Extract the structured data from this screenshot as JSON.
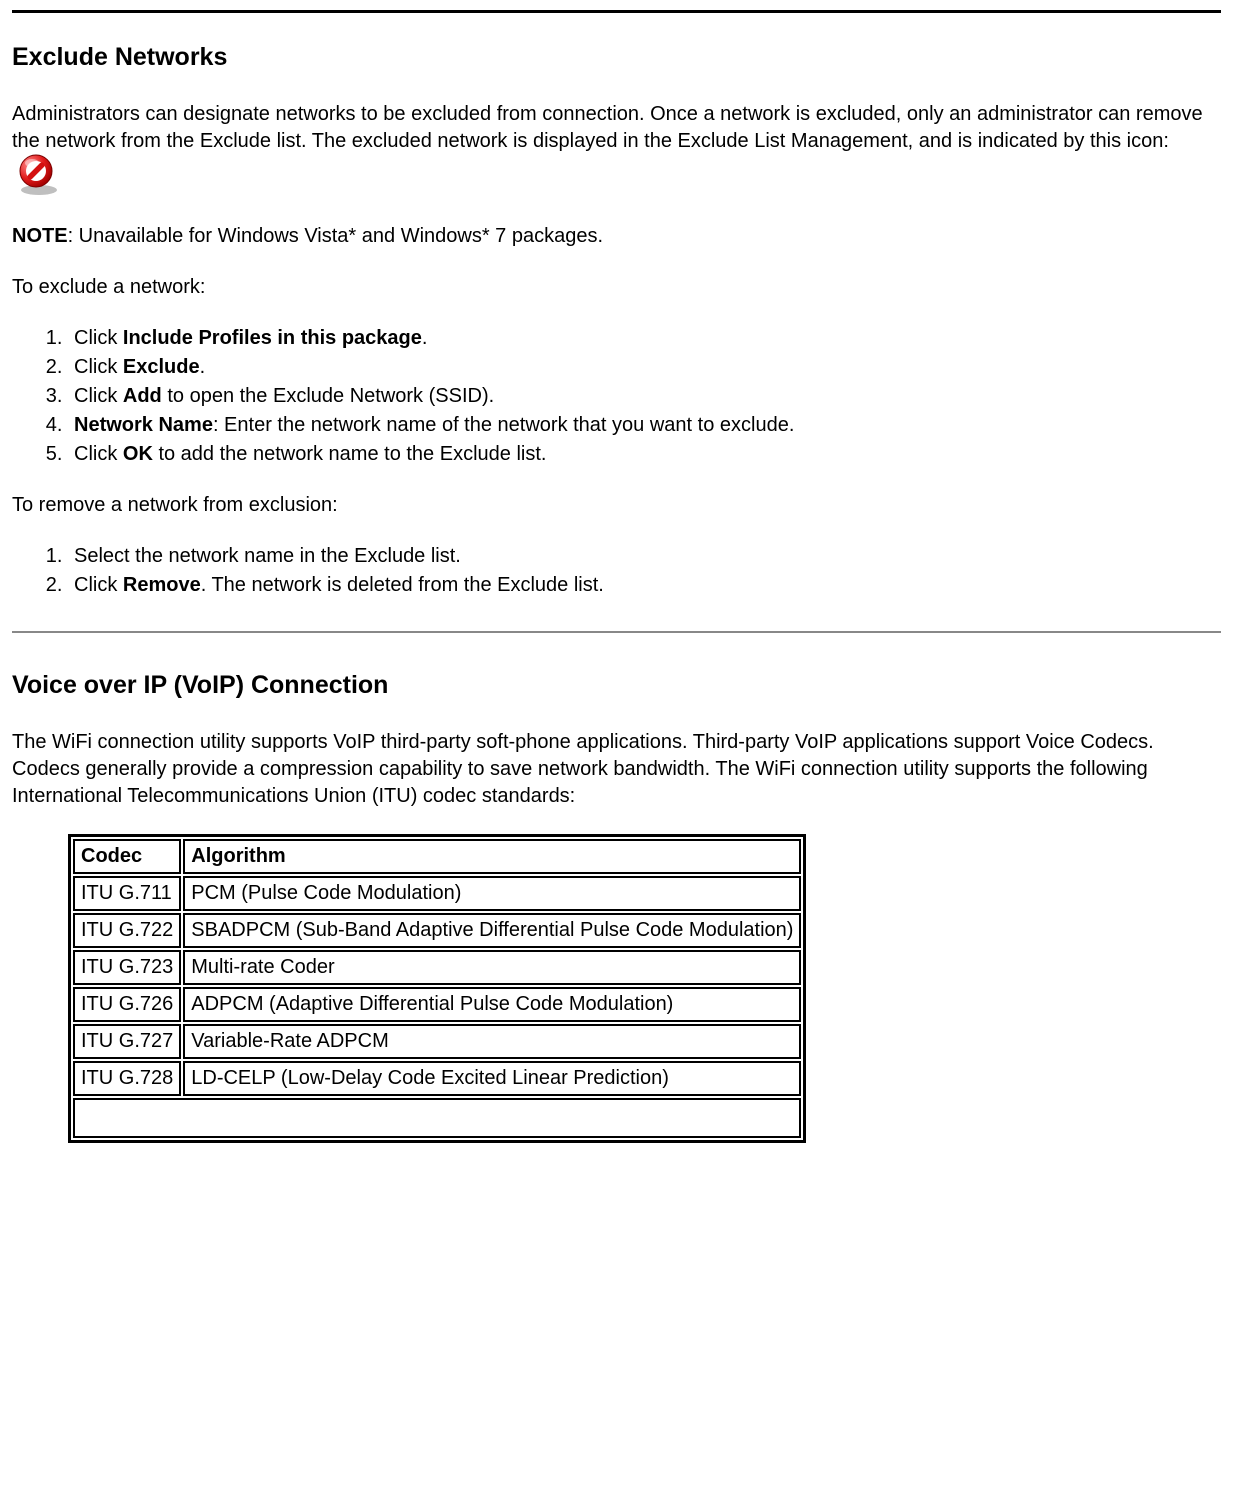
{
  "section1": {
    "heading": "Exclude Networks",
    "para_before_icon": "Administrators can designate networks to be excluded from connection. Once a network is excluded, only an administrator can remove the network from the Exclude list. The excluded network is displayed in the Exclude List Management, and is indicated by this icon:",
    "note_label": "NOTE",
    "note_text": ": Unavailable for Windows Vista* and Windows* 7 packages.",
    "to_exclude_intro": "To exclude a network:",
    "exclude_steps": [
      {
        "pre": "Click ",
        "bold": "Include Profiles in this package",
        "post": "."
      },
      {
        "pre": "Click ",
        "bold": "Exclude",
        "post": "."
      },
      {
        "pre": "Click ",
        "bold": "Add",
        "post": " to open the Exclude Network (SSID)."
      },
      {
        "pre": "",
        "bold": "Network Name",
        "post": ": Enter the network name of the network that you want to exclude."
      },
      {
        "pre": "Click ",
        "bold": "OK",
        "post": " to add the network name to the Exclude list."
      }
    ],
    "to_remove_intro": "To remove a network from exclusion:",
    "remove_steps": [
      {
        "pre": "Select the network name in the Exclude list.",
        "bold": "",
        "post": ""
      },
      {
        "pre": "Click ",
        "bold": "Remove",
        "post": ". The network is deleted from the Exclude list."
      }
    ]
  },
  "section2": {
    "heading": "Voice over IP (VoIP) Connection",
    "para": "The WiFi connection utility supports VoIP third-party soft-phone applications. Third-party VoIP applications support Voice Codecs. Codecs generally provide a compression capability to save network bandwidth. The WiFi connection utility supports the following International Telecommunications Union (ITU) codec standards:",
    "table": {
      "headers": [
        "Codec",
        "Algorithm"
      ],
      "rows": [
        [
          "ITU G.711",
          "PCM (Pulse Code Modulation)"
        ],
        [
          "ITU G.722",
          "SBADPCM (Sub-Band Adaptive Differential Pulse Code Modulation)"
        ],
        [
          "ITU G.723",
          "Multi-rate Coder"
        ],
        [
          "ITU G.726",
          "ADPCM (Adaptive Differential Pulse Code Modulation)"
        ],
        [
          "ITU G.727",
          "Variable-Rate ADPCM"
        ],
        [
          "ITU G.728",
          "LD-CELP (Low-Delay Code Excited Linear Prediction)"
        ]
      ]
    }
  },
  "icons": {
    "exclude_icon_name": "prohibit-icon"
  }
}
